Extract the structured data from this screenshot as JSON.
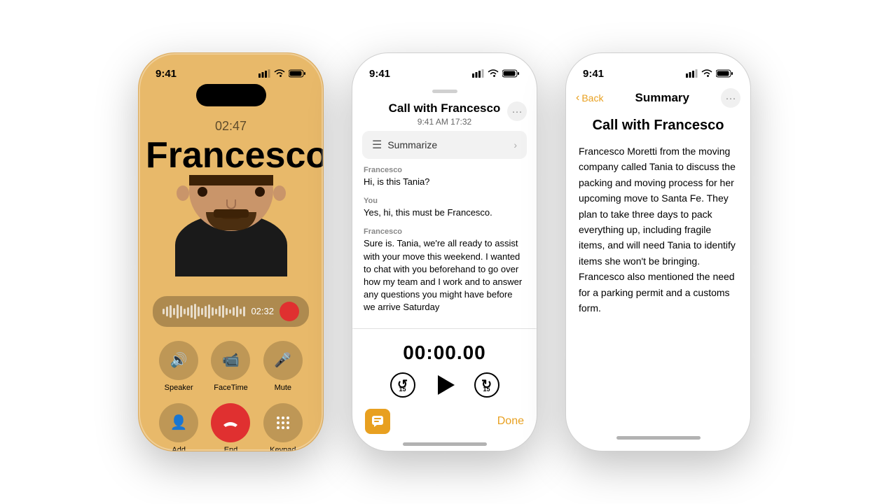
{
  "phone1": {
    "status_time": "9:41",
    "call_duration": "02:47",
    "caller_name": "Francesco",
    "waveform_time": "02:32",
    "buttons": [
      {
        "icon": "🔊",
        "label": "Speaker"
      },
      {
        "icon": "📷",
        "label": "FaceTime"
      },
      {
        "icon": "🎤",
        "label": "Mute"
      },
      {
        "icon": "👤",
        "label": "Add"
      },
      {
        "icon": "☎",
        "label": "End"
      },
      {
        "icon": "⌨",
        "label": "Keypad"
      }
    ]
  },
  "phone2": {
    "status_time": "9:41",
    "title": "Call with Francesco",
    "subtitle": "9:41 AM  17:32",
    "summarize_label": "Summarize",
    "messages": [
      {
        "speaker": "Francesco",
        "text": "Hi, is this Tania?"
      },
      {
        "speaker": "You",
        "text": "Yes, hi, this must be Francesco."
      },
      {
        "speaker": "Francesco",
        "text": "Sure is. Tania, we're all ready to assist with your move this weekend. I wanted to chat with you beforehand to go over how my team and I work and to answer any questions you might have before we arrive Saturday"
      }
    ],
    "playback_time": "00:00.00",
    "done_label": "Done",
    "skip_back": "15",
    "skip_forward": "15"
  },
  "phone3": {
    "status_time": "9:41",
    "back_label": "Back",
    "nav_title": "Summary",
    "call_title": "Call with Francesco",
    "summary_text": "Francesco Moretti from the moving company called Tania to discuss the packing and moving process for her upcoming move to Santa Fe. They plan to take three days to pack everything up, including fragile items, and will need Tania to identify items she won't be bringing. Francesco also mentioned the need for a parking permit and a customs form."
  }
}
